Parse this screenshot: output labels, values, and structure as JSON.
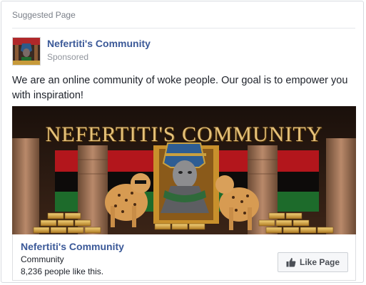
{
  "header": {
    "label": "Suggested Page"
  },
  "page": {
    "name": "Nefertiti's Community",
    "sponsored_label": "Sponsored"
  },
  "post": {
    "text": "We are an online community of woke people. Our goal is to empower you with inspiration!"
  },
  "hero_image": {
    "title": "NEFERTITI'S COMMUNITY",
    "description_icons": [
      "nefertiti-bust",
      "cheetah",
      "gold-bars",
      "egyptian-columns",
      "flag-stripes"
    ]
  },
  "footer": {
    "name": "Nefertiti's Community",
    "type": "Community",
    "likes": "8,236 people like this.",
    "like_button_label": "Like Page",
    "like_icon": "thumbs-up-icon"
  },
  "colors": {
    "link_blue": "#3b5998",
    "muted_gray": "#90949c",
    "text_dark": "#1d2129",
    "button_bg": "#f6f7f9",
    "gold_title": "#e6c27a"
  }
}
